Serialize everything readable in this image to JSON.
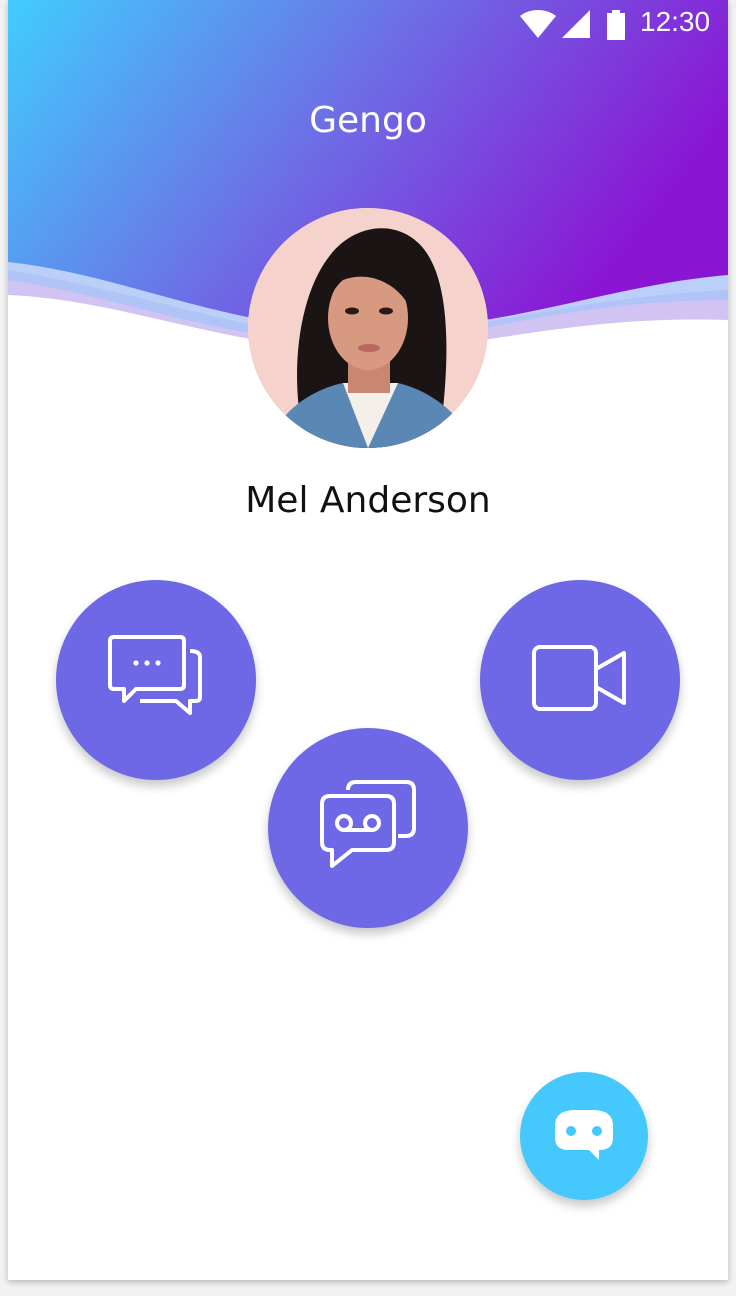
{
  "status_bar": {
    "time": "12:30",
    "icons": [
      "wifi-icon",
      "signal-icon",
      "battery-icon"
    ]
  },
  "header": {
    "app_title": "Gengo",
    "gradient_start": "#41cdfd",
    "gradient_end": "#8a16d4"
  },
  "contact": {
    "name": "Mel Anderson",
    "avatar": "avatar-photo"
  },
  "actions": [
    {
      "icon": "chat-bubbles-icon",
      "color": "#6e68e6"
    },
    {
      "icon": "video-camera-icon",
      "color": "#6e68e6"
    },
    {
      "icon": "voicemail-icon",
      "color": "#6e68e6"
    }
  ],
  "fab": {
    "icon": "bot-icon",
    "color": "#45c8fb"
  }
}
